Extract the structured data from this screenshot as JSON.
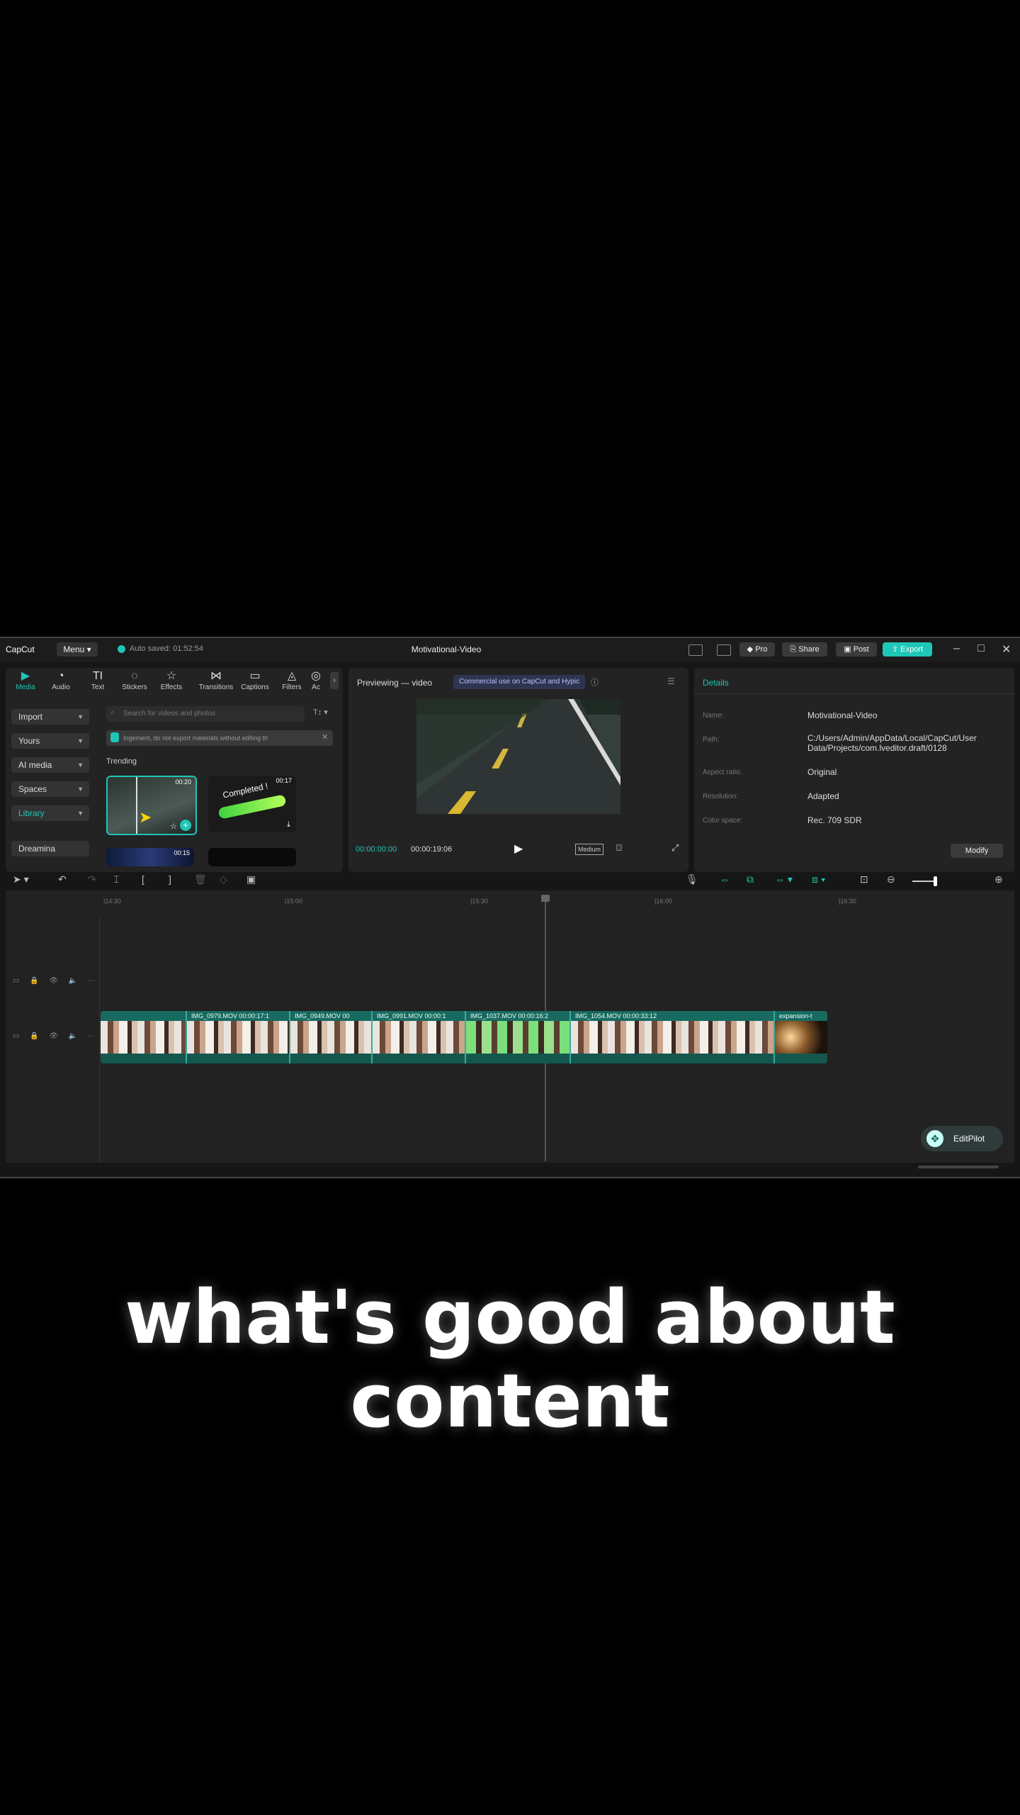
{
  "app": {
    "logo": "CapCut",
    "menu_label": "Menu ▾",
    "autosave": "Auto saved: 01:52:54",
    "title": "Motivational-Video",
    "pro_label": "Pro",
    "share_label": "Share",
    "post_label": "Post",
    "export_label": "Export",
    "accent": "#20c5b5"
  },
  "tabs": [
    {
      "label": "Media",
      "icon": "media-icon"
    },
    {
      "label": "Audio",
      "icon": "audio-icon"
    },
    {
      "label": "Text",
      "icon": "text-icon"
    },
    {
      "label": "Stickers",
      "icon": "stickers-icon"
    },
    {
      "label": "Effects",
      "icon": "effects-icon"
    },
    {
      "label": "Transitions",
      "icon": "transitions-icon"
    },
    {
      "label": "Captions",
      "icon": "captions-icon"
    },
    {
      "label": "Filters",
      "icon": "filters-icon"
    },
    {
      "label": "Ac",
      "icon": "adjust-icon"
    }
  ],
  "sidebar": [
    "Import",
    "Yours",
    "AI media",
    "Spaces",
    "Library",
    "Dreamina"
  ],
  "media": {
    "search_placeholder": "Search for videos and photos",
    "notice": "Ingement, do not export materials without editing th",
    "trending": "Trending",
    "thumb1_time": "00:20",
    "thumb2_time": "00:17",
    "thumb2_text": "Completed !",
    "thumb3_time": "00:15"
  },
  "preview": {
    "title": "Previewing — video",
    "commercial": "Commercial use on CapCut and Hypic",
    "current_time": "00:00:00:00",
    "total_time": "00:00:19:06",
    "quality": "Medium"
  },
  "details": {
    "header": "Details",
    "rows": [
      {
        "label": "Name:",
        "value": "Motivational-Video"
      },
      {
        "label": "Path:",
        "value": "C:/Users/Admin/AppData/Local/CapCut/User Data/Projects/com.lveditor.draft/0128"
      },
      {
        "label": "Aspect ratio:",
        "value": "Original"
      },
      {
        "label": "Resolution:",
        "value": "Adapted"
      },
      {
        "label": "Color space:",
        "value": "Rec. 709 SDR"
      }
    ],
    "modify_label": "Modify"
  },
  "timeline": {
    "ruler": [
      "|14:30",
      "|15:00",
      "|15:30",
      "|16:00",
      "|16:30"
    ],
    "clips": [
      {
        "label": ""
      },
      {
        "label": "IMG_0979.MOV  00:00:17:1"
      },
      {
        "label": "IMG_0949.MOV  00"
      },
      {
        "label": "IMG_0991.MOV  00:00:1"
      },
      {
        "label": "IMG_1037.MOV  00:00:16:2"
      },
      {
        "label": "IMG_1054.MOV  00:00:33:12"
      },
      {
        "label": "expansion-t"
      }
    ]
  },
  "editpilot": "EditPilot",
  "subtitle": {
    "line1": "what's good about",
    "line2": "content"
  }
}
